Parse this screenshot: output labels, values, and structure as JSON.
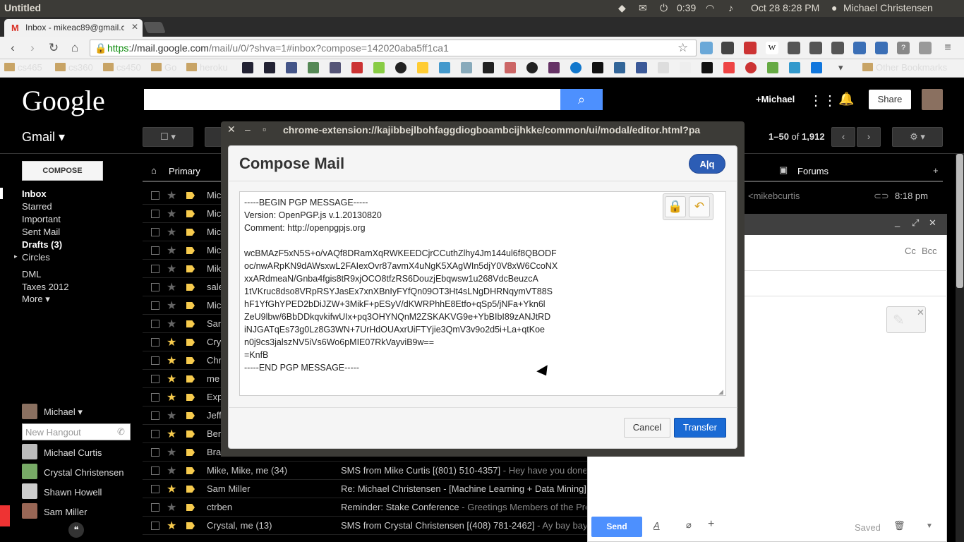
{
  "os_bar": {
    "window_title": "Untitled",
    "time": "0:39",
    "datetime": "Oct 28  8:28 PM",
    "user": "Michael Christensen"
  },
  "browser": {
    "tab_title": "Inbox - mikeac89@gmail.c",
    "url_https": "https",
    "url_host": "://mail.google.com",
    "url_rest": "/mail/u/0/?shva=1#inbox?compose=142020aba5ff1ca1",
    "bookmarks": [
      "cs465",
      "cs360",
      "cs450",
      "Go",
      "heroku"
    ],
    "other_bookmarks": "Other Bookmarks"
  },
  "google": {
    "logo": "Google",
    "plus_name": "+Michael",
    "share_label": "Share"
  },
  "gmail": {
    "label": "Gmail",
    "range": "1–50",
    "of": "of",
    "total": "1,912",
    "compose_label": "COMPOSE",
    "nav": [
      "Inbox",
      "Starred",
      "Important",
      "Sent Mail",
      "Drafts (3)",
      "Circles",
      "DML",
      "Taxes 2012",
      "More"
    ],
    "tabs": {
      "primary": "Primary",
      "forums": "Forums"
    },
    "hangouts": {
      "me": "Michael",
      "input_placeholder": "New Hangout",
      "contacts": [
        "Michael Curtis",
        "Crystal Christensen",
        "Shawn Howell",
        "Sam Miller"
      ]
    },
    "first_row_right": "<mikebcurtis",
    "first_row_time": "8:18 pm",
    "rows": [
      {
        "sender": "Mic",
        "subject": "",
        "starred": false
      },
      {
        "sender": "Mic",
        "subject": "",
        "starred": false
      },
      {
        "sender": "Mic",
        "subject": "",
        "starred": false
      },
      {
        "sender": "Mic",
        "subject": "",
        "starred": false
      },
      {
        "sender": "Mik",
        "subject": "",
        "starred": false
      },
      {
        "sender": "sale",
        "subject": "",
        "starred": false
      },
      {
        "sender": "Mic",
        "subject": "",
        "starred": false
      },
      {
        "sender": "San",
        "subject": "",
        "starred": false
      },
      {
        "sender": "Cry",
        "subject": "",
        "starred": true
      },
      {
        "sender": "Chr",
        "subject": "",
        "starred": true
      },
      {
        "sender": "me",
        "subject": "",
        "starred": true
      },
      {
        "sender": "Exp",
        "subject": "",
        "starred": true
      },
      {
        "sender": "Jeff",
        "subject": "",
        "starred": false
      },
      {
        "sender": "Ben",
        "subject": "",
        "starred": true
      },
      {
        "sender": "Bra",
        "subject": "",
        "starred": false
      },
      {
        "sender": "Mike, Mike, me (34)",
        "subject": "SMS from Mike Curtis [(801) 510-4357]",
        "preview": " - Hey have you done",
        "starred": false
      },
      {
        "sender": "Sam Miller",
        "subject": "Re: Michael Christensen - [Machine Learning + Data Mining]",
        "preview": "",
        "starred": true
      },
      {
        "sender": "ctrben",
        "subject": "Reminder: Stake Conference",
        "preview": " - Greetings Members of the Pro",
        "starred": false
      },
      {
        "sender": "Crystal, me (13)",
        "subject": "SMS from Crystal Christensen [(408) 781-2462]",
        "preview": " - Ay bay bay",
        "starred": true
      }
    ],
    "compose_panel": {
      "cc": "Cc",
      "bcc": "Bcc",
      "send": "Send",
      "saved": "Saved"
    }
  },
  "modal": {
    "window_url": "chrome-extension://kajibbejlbohfaggdiogboambcijhkke/common/ui/modal/editor.html?pa",
    "heading": "Compose Mail",
    "aq_label": "A|q",
    "pgp_lines": [
      "-----BEGIN PGP MESSAGE-----",
      "Version: OpenPGP.js v.1.20130820",
      "Comment: http://openpgpjs.org",
      "",
      "wcBMAzF5xN5S+o/vAQf8DRamXqRWKEEDCjrCCuthZlhy4Jm144ul6f8QBODF",
      "oc/nwARpKN9dAWsxwL2FAIexOvr87avmX4uNgK5XAgWIn5djY0V8xW6CcoNX",
      "xxARdmeaN/Gnba4fgis8tR9xjOCO8tfzRS6DouzjEbqwsw1u268VdcBeuzcA",
      "1tVKruc8dso8VRpRSYJasEx7xnXBnIyFYfQn09OT3Ht4sLNgDHRNqymVT88S",
      "hF1YfGhYPED2bDiJZW+3MikF+pESyV/dKWRPhhE8Etfo+qSp5/jNFa+Ykn6l",
      "ZeU9lbw/6BbDDkqvkifwUIx+pq3OHYNQnM2ZSKAKVG9e+YbBIbI89zANJtRD",
      "iNJGATqEs73g0Lz8G3WN+7UrHdOUAxrUiFTYjie3QmV3v9o2d5i+La+qtKoe",
      "n0j9cs3jalszNV5iVs6Wo6pMIE07RkVayviB9w==",
      "=KnfB",
      "-----END PGP MESSAGE-----"
    ],
    "cancel": "Cancel",
    "transfer": "Transfer"
  }
}
